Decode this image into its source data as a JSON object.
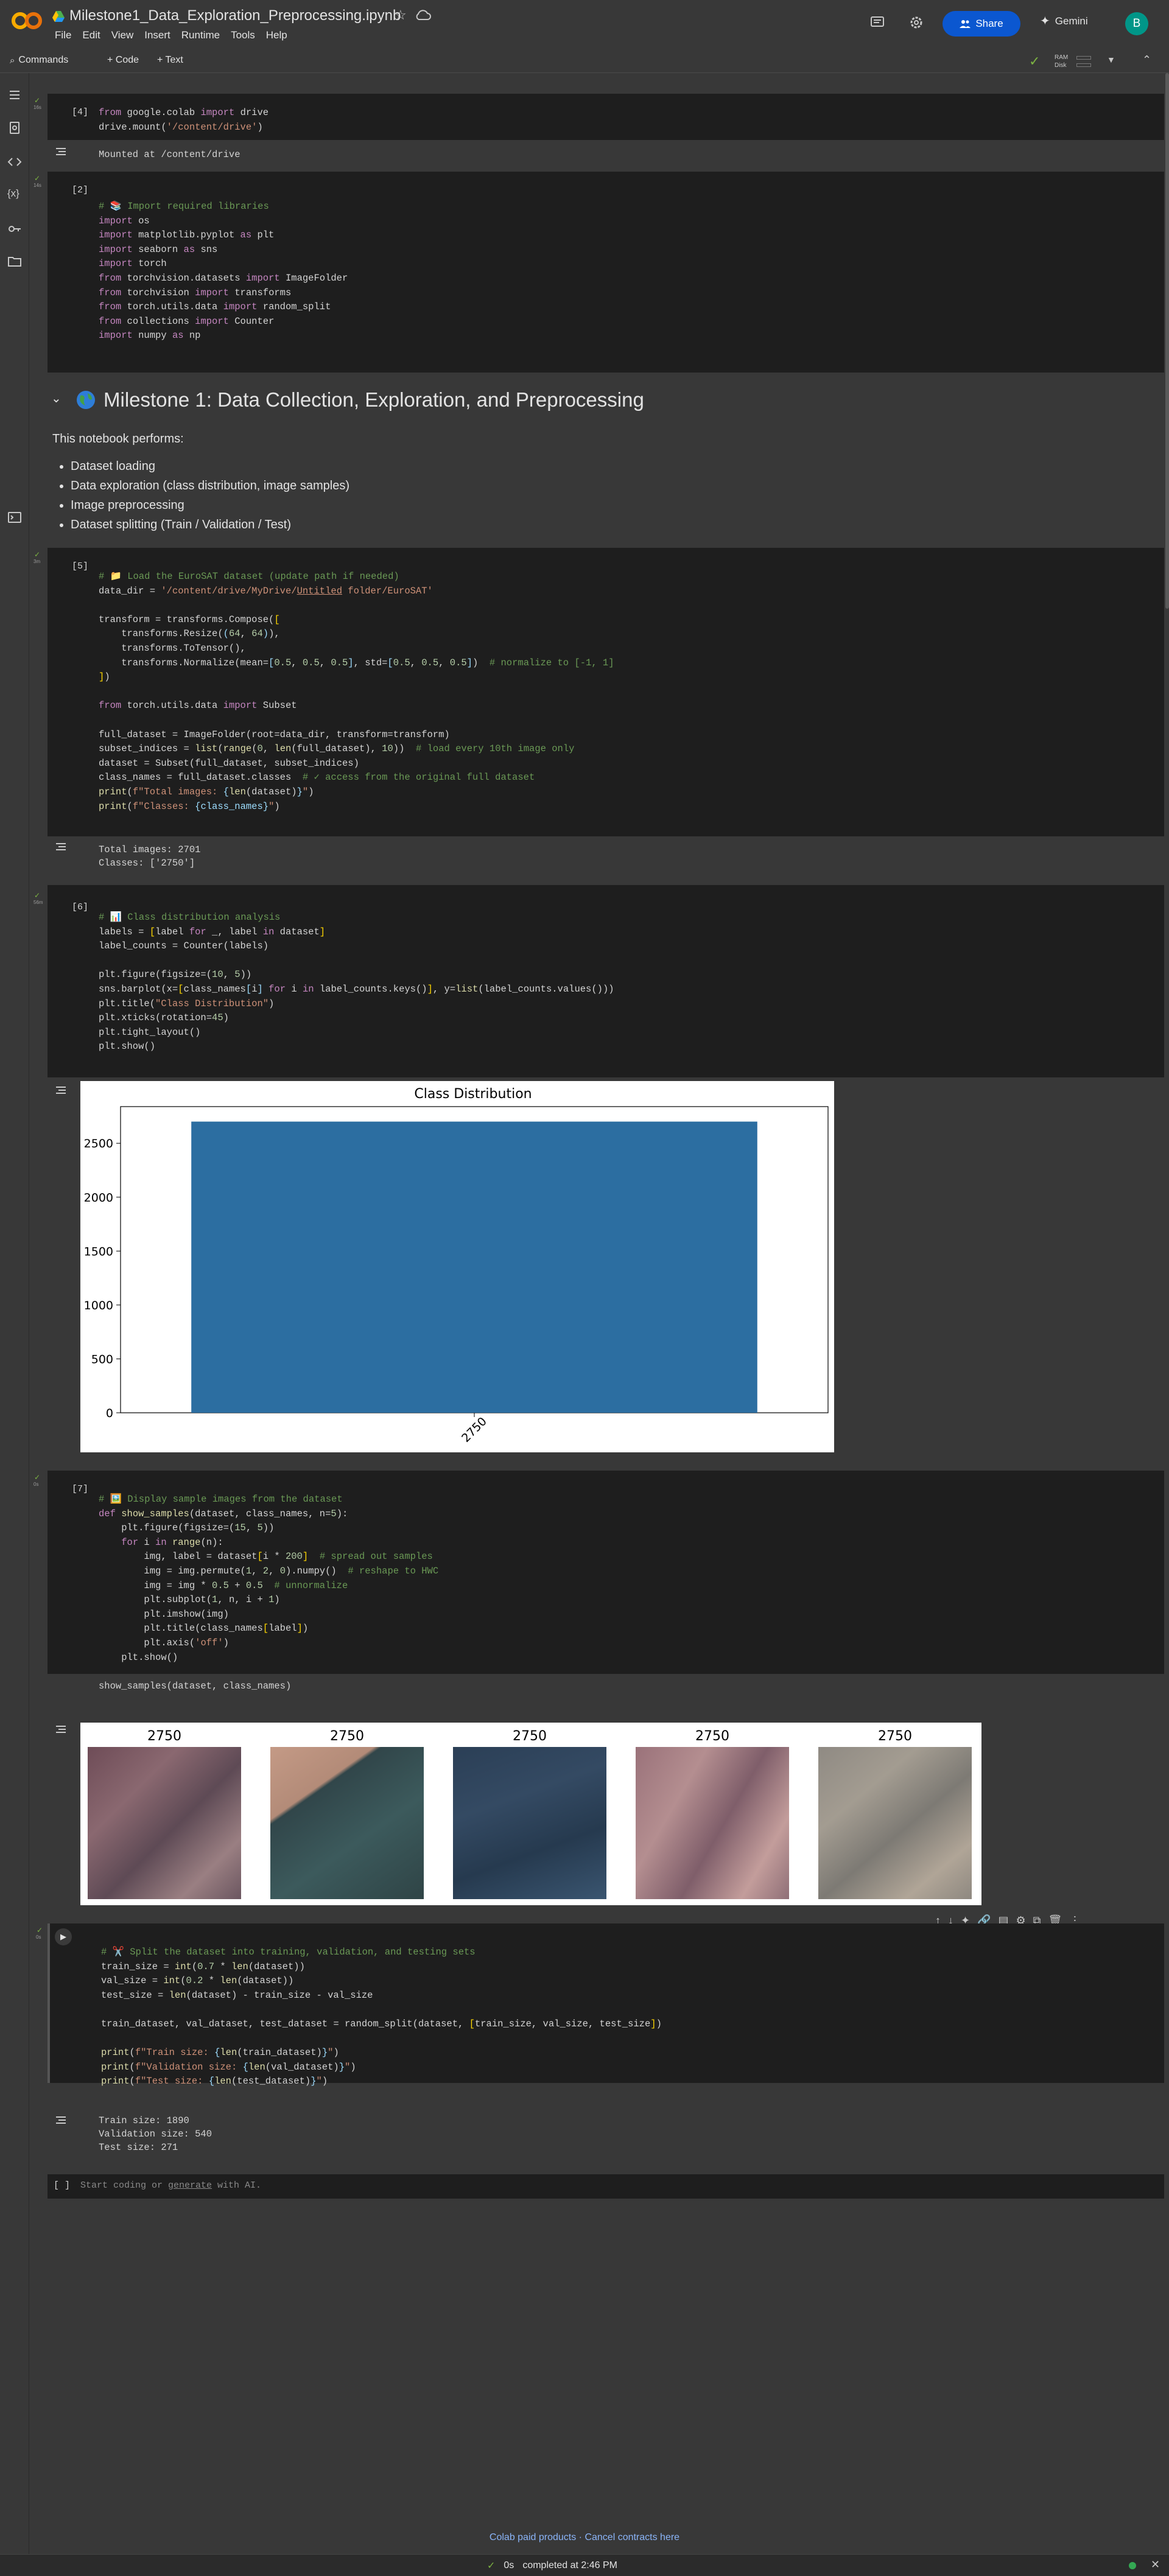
{
  "app": {
    "notebook_title": "Milestone1_Data_Exploration_Preprocessing.ipynb",
    "menu": [
      "File",
      "Edit",
      "View",
      "Insert",
      "Runtime",
      "Tools",
      "Help"
    ],
    "share_label": "Share",
    "gemini_label": "Gemini",
    "avatar_letter": "B",
    "accent": "#0b57d0"
  },
  "toolbar": {
    "commands_label": "Commands",
    "code_label": "+ Code",
    "text_label": "+ Text",
    "ram_label": "RAM",
    "disk_label": "Disk"
  },
  "cells": {
    "c4": {
      "exec": "[4]",
      "time": "16s",
      "output": "Mounted at /content/drive"
    },
    "c2": {
      "exec": "[2]",
      "time": "14s"
    },
    "c5": {
      "exec": "[5]",
      "time": "3m",
      "output_line1": "Total images: 2701",
      "output_line2": "Classes: ['2750']"
    },
    "c6": {
      "exec": "[6]",
      "time": "56m"
    },
    "c7": {
      "exec": "[7]",
      "time": "0s"
    },
    "c8": {
      "time": "0s",
      "output_line1": "Train size: 1890",
      "output_line2": "Validation size: 540",
      "output_line3": "Test size: 271"
    },
    "empty": {
      "exec": "[ ]",
      "placeholder_a": "Start coding or ",
      "placeholder_link": "generate",
      "placeholder_b": " with AI."
    }
  },
  "markdown": {
    "heading": "Milestone 1: Data Collection, Exploration, and Preprocessing",
    "intro": "This notebook performs:",
    "items": [
      "Dataset loading",
      "Data exploration (class distribution, image samples)",
      "Image preprocessing",
      "Dataset splitting (Train / Validation / Test)"
    ]
  },
  "chart_data": {
    "type": "bar",
    "title": "Class Distribution",
    "categories": [
      "2750"
    ],
    "values": [
      2701
    ],
    "ylim": [
      0,
      2840
    ],
    "yticks": [
      0,
      500,
      1000,
      1500,
      2000,
      2500
    ],
    "bar_color": "#2c6ea1",
    "grid": false
  },
  "samples": {
    "titles": [
      "2750",
      "2750",
      "2750",
      "2750",
      "2750"
    ]
  },
  "footer": {
    "links": "Colab paid products  ·  Cancel contracts here",
    "status_time": "0s",
    "status_text": "completed at 2:46 PM"
  }
}
